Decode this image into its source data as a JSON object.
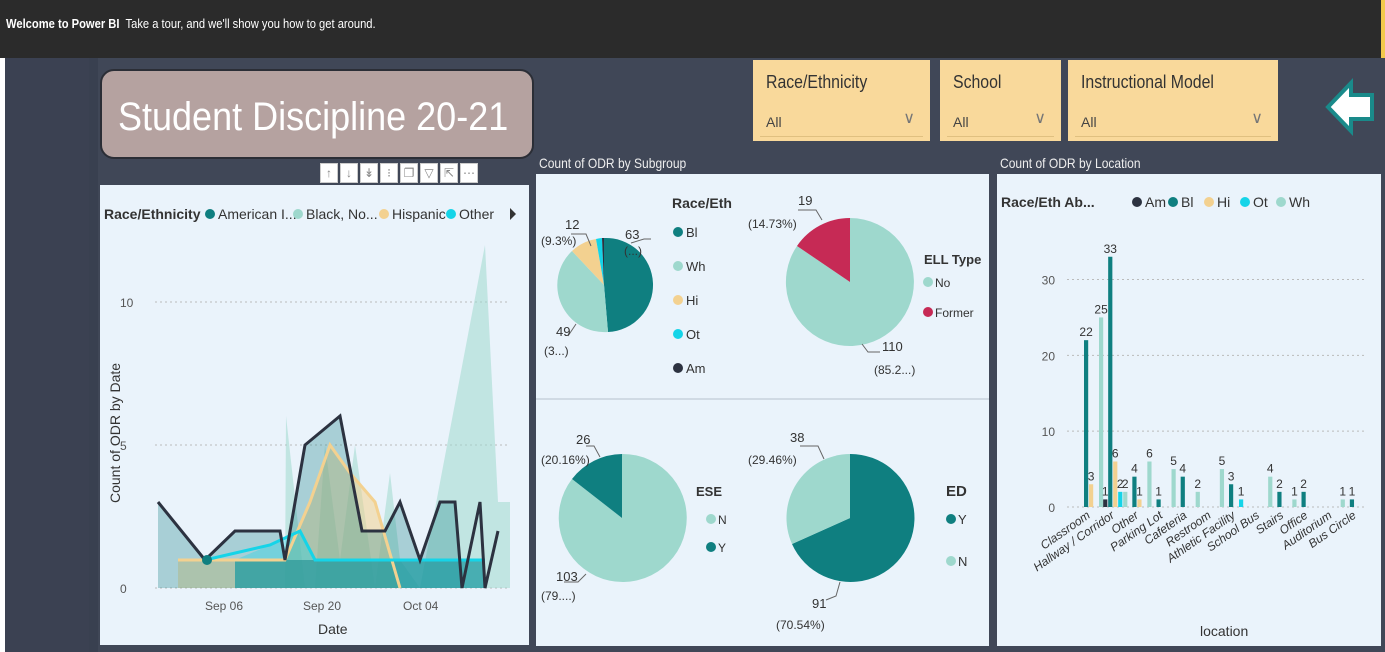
{
  "banner": {
    "bold": "Welcome to Power BI",
    "text": "Take a tour, and we'll show you how to get around."
  },
  "report": {
    "title": "Student Discipline 20-21"
  },
  "slicers": [
    {
      "label": "Race/Ethnicity",
      "value": "All"
    },
    {
      "label": "School",
      "value": "All"
    },
    {
      "label": "Instructional Model",
      "value": "All"
    }
  ],
  "colors": {
    "Am": "#2c3240",
    "Bl": "#0f7f80",
    "Hi": "#f3d190",
    "Ot": "#15d4e8",
    "Wh": "#9ed8cd",
    "Former": "#c62a55"
  },
  "toolbar_icons": [
    "arrow-up-icon",
    "arrow-down-icon",
    "double-arrow-down-icon",
    "expand-hierarchy-icon",
    "copy-icon",
    "filter-icon",
    "focus-mode-icon",
    "more-options-icon"
  ],
  "line_chart": {
    "legend_title": "Race/Ethnicity",
    "legend": [
      "American I...",
      "Black, No...",
      "Hispanic",
      "Other"
    ],
    "ylabel": "Count of ODR by Date",
    "xlabel": "Date",
    "yticks": [
      "0",
      "5",
      "10"
    ],
    "xticks": [
      "Sep 06",
      "Sep 20",
      "Oct 04"
    ]
  },
  "subgroup_title": "Count of ODR by Subgroup",
  "race_pie": {
    "legend_title": "Race/Eth",
    "legend": [
      "Bl",
      "Wh",
      "Hi",
      "Ot",
      "Am"
    ],
    "labels": [
      {
        "value": "12",
        "pct": "(9.3%)"
      },
      {
        "value": "63",
        "pct": "(...)"
      },
      {
        "value": "49",
        "pct": "(3...)"
      }
    ]
  },
  "ell_pie": {
    "legend_title": "ELL Type",
    "legend": [
      "No",
      "Former"
    ],
    "labels": [
      {
        "value": "19",
        "pct": "(14.73%)"
      },
      {
        "value": "110",
        "pct": "(85.2...)"
      }
    ]
  },
  "ese_pie": {
    "legend_title": "ESE",
    "legend": [
      "N",
      "Y"
    ],
    "labels": [
      {
        "value": "26",
        "pct": "(20.16%)"
      },
      {
        "value": "103",
        "pct": "(79....)"
      }
    ]
  },
  "ed_pie": {
    "legend_title": "ED",
    "legend": [
      "Y",
      "N"
    ],
    "labels": [
      {
        "value": "38",
        "pct": "(29.46%)"
      },
      {
        "value": "91",
        "pct": "(70.54%)"
      }
    ]
  },
  "location_title": "Count of ODR by Location",
  "chart_data": {
    "type": "bar",
    "legend_title": "Race/Eth Ab...",
    "xlabel": "location",
    "ylabel": "",
    "ylim": [
      0,
      36
    ],
    "yticks": [
      0,
      10,
      20,
      30
    ],
    "categories": [
      "Classroom",
      "Hallway / Corridor",
      "Other",
      "Parking Lot",
      "Cafeteria",
      "Restroom",
      "Athletic Facility",
      "School Bus",
      "Stairs",
      "Office",
      "Auditorium",
      "Bus Circle"
    ],
    "series": [
      {
        "name": "Am",
        "values": [
          0,
          1,
          0,
          0,
          0,
          0,
          0,
          0,
          0,
          0,
          0,
          0
        ]
      },
      {
        "name": "Bl",
        "values": [
          22,
          33,
          4,
          1,
          4,
          0,
          3,
          0,
          2,
          2,
          0,
          1
        ]
      },
      {
        "name": "Hi",
        "values": [
          3,
          6,
          1,
          0,
          0,
          0,
          0,
          0,
          0,
          0,
          0,
          0
        ]
      },
      {
        "name": "Ot",
        "values": [
          0,
          2,
          0,
          0,
          0,
          0,
          1,
          0,
          0,
          0,
          0,
          0
        ]
      },
      {
        "name": "Wh",
        "values": [
          25,
          2,
          6,
          5,
          2,
          5,
          0,
          4,
          1,
          0,
          1,
          0
        ]
      }
    ]
  }
}
